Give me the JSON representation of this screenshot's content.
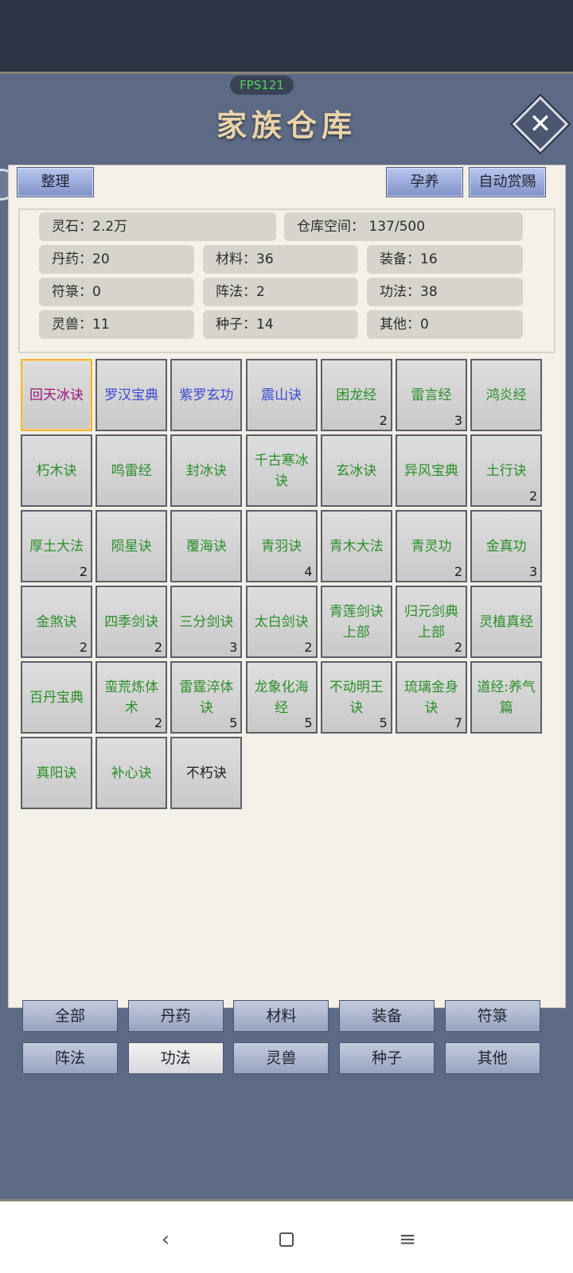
{
  "fps": "FPS121",
  "title": "家族仓库",
  "buttons": {
    "organize": "整理",
    "nurture": "孕养",
    "auto_reward": "自动赏赐"
  },
  "stats": {
    "spirit_stone": "灵石：2.2万",
    "storage": "仓库空间：  137/500",
    "pills": "丹药：20",
    "materials": "材料：36",
    "equipment": "装备：16",
    "talismans": "符箓：0",
    "formations": "阵法：2",
    "techniques": "功法：38",
    "beasts": "灵兽：11",
    "seeds": "种子：14",
    "others": "其他：0"
  },
  "items": [
    {
      "name": "回天冰诀",
      "count": "",
      "color": "#a0147b"
    },
    {
      "name": "罗汉宝典",
      "count": "",
      "color": "#3d48d4"
    },
    {
      "name": "紫罗玄功",
      "count": "",
      "color": "#3d48d4"
    },
    {
      "name": "震山诀",
      "count": "",
      "color": "#3d48d4"
    },
    {
      "name": "困龙经",
      "count": "2",
      "color": "#2a8d2a"
    },
    {
      "name": "雷言经",
      "count": "3",
      "color": "#2a8d2a"
    },
    {
      "name": "鸿炎经",
      "count": "",
      "color": "#2a8d2a"
    },
    {
      "name": "朽木诀",
      "count": "",
      "color": "#2a8d2a"
    },
    {
      "name": "鸣雷经",
      "count": "",
      "color": "#2a8d2a"
    },
    {
      "name": "封冰诀",
      "count": "",
      "color": "#2a8d2a"
    },
    {
      "name": "千古寒冰诀",
      "count": "",
      "color": "#2a8d2a"
    },
    {
      "name": "玄冰诀",
      "count": "",
      "color": "#2a8d2a"
    },
    {
      "name": "异风宝典",
      "count": "",
      "color": "#2a8d2a"
    },
    {
      "name": "土行诀",
      "count": "2",
      "color": "#2a8d2a"
    },
    {
      "name": "厚土大法",
      "count": "2",
      "color": "#2a8d2a"
    },
    {
      "name": "陨星诀",
      "count": "",
      "color": "#2a8d2a"
    },
    {
      "name": "覆海诀",
      "count": "",
      "color": "#2a8d2a"
    },
    {
      "name": "青羽诀",
      "count": "4",
      "color": "#2a8d2a"
    },
    {
      "name": "青木大法",
      "count": "",
      "color": "#2a8d2a"
    },
    {
      "name": "青灵功",
      "count": "2",
      "color": "#2a8d2a"
    },
    {
      "name": "金真功",
      "count": "3",
      "color": "#2a8d2a"
    },
    {
      "name": "金煞诀",
      "count": "2",
      "color": "#2a8d2a"
    },
    {
      "name": "四季剑诀",
      "count": "2",
      "color": "#2a8d2a"
    },
    {
      "name": "三分剑诀",
      "count": "3",
      "color": "#2a8d2a"
    },
    {
      "name": "太白剑诀",
      "count": "2",
      "color": "#2a8d2a"
    },
    {
      "name": "青莲剑诀上部",
      "count": "",
      "color": "#2a8d2a"
    },
    {
      "name": "归元剑典上部",
      "count": "2",
      "color": "#2a8d2a"
    },
    {
      "name": "灵植真经",
      "count": "",
      "color": "#2a8d2a"
    },
    {
      "name": "百丹宝典",
      "count": "",
      "color": "#2a8d2a"
    },
    {
      "name": "蛮荒炼体术",
      "count": "2",
      "color": "#2a8d2a"
    },
    {
      "name": "雷霆淬体诀",
      "count": "5",
      "color": "#2a8d2a"
    },
    {
      "name": "龙象化海经",
      "count": "5",
      "color": "#2a8d2a"
    },
    {
      "name": "不动明王诀",
      "count": "5",
      "color": "#2a8d2a"
    },
    {
      "name": "琉璃金身诀",
      "count": "7",
      "color": "#2a8d2a"
    },
    {
      "name": "道经:养气篇",
      "count": "",
      "color": "#2a8d2a"
    },
    {
      "name": "真阳诀",
      "count": "",
      "color": "#2a8d2a"
    },
    {
      "name": "补心诀",
      "count": "",
      "color": "#2a8d2a"
    },
    {
      "name": "不朽诀",
      "count": "",
      "color": "#1d1d1d"
    }
  ],
  "tabs": [
    {
      "label": "全部",
      "active": false
    },
    {
      "label": "丹药",
      "active": false
    },
    {
      "label": "材料",
      "active": false
    },
    {
      "label": "装备",
      "active": false
    },
    {
      "label": "符箓",
      "active": false
    },
    {
      "label": "阵法",
      "active": false
    },
    {
      "label": "功法",
      "active": true
    },
    {
      "label": "灵兽",
      "active": false
    },
    {
      "label": "种子",
      "active": false
    },
    {
      "label": "其他",
      "active": false
    }
  ],
  "nav": {
    "back_icon": "back-icon",
    "home_icon": "home-icon",
    "menu_icon": "menu-icon"
  }
}
